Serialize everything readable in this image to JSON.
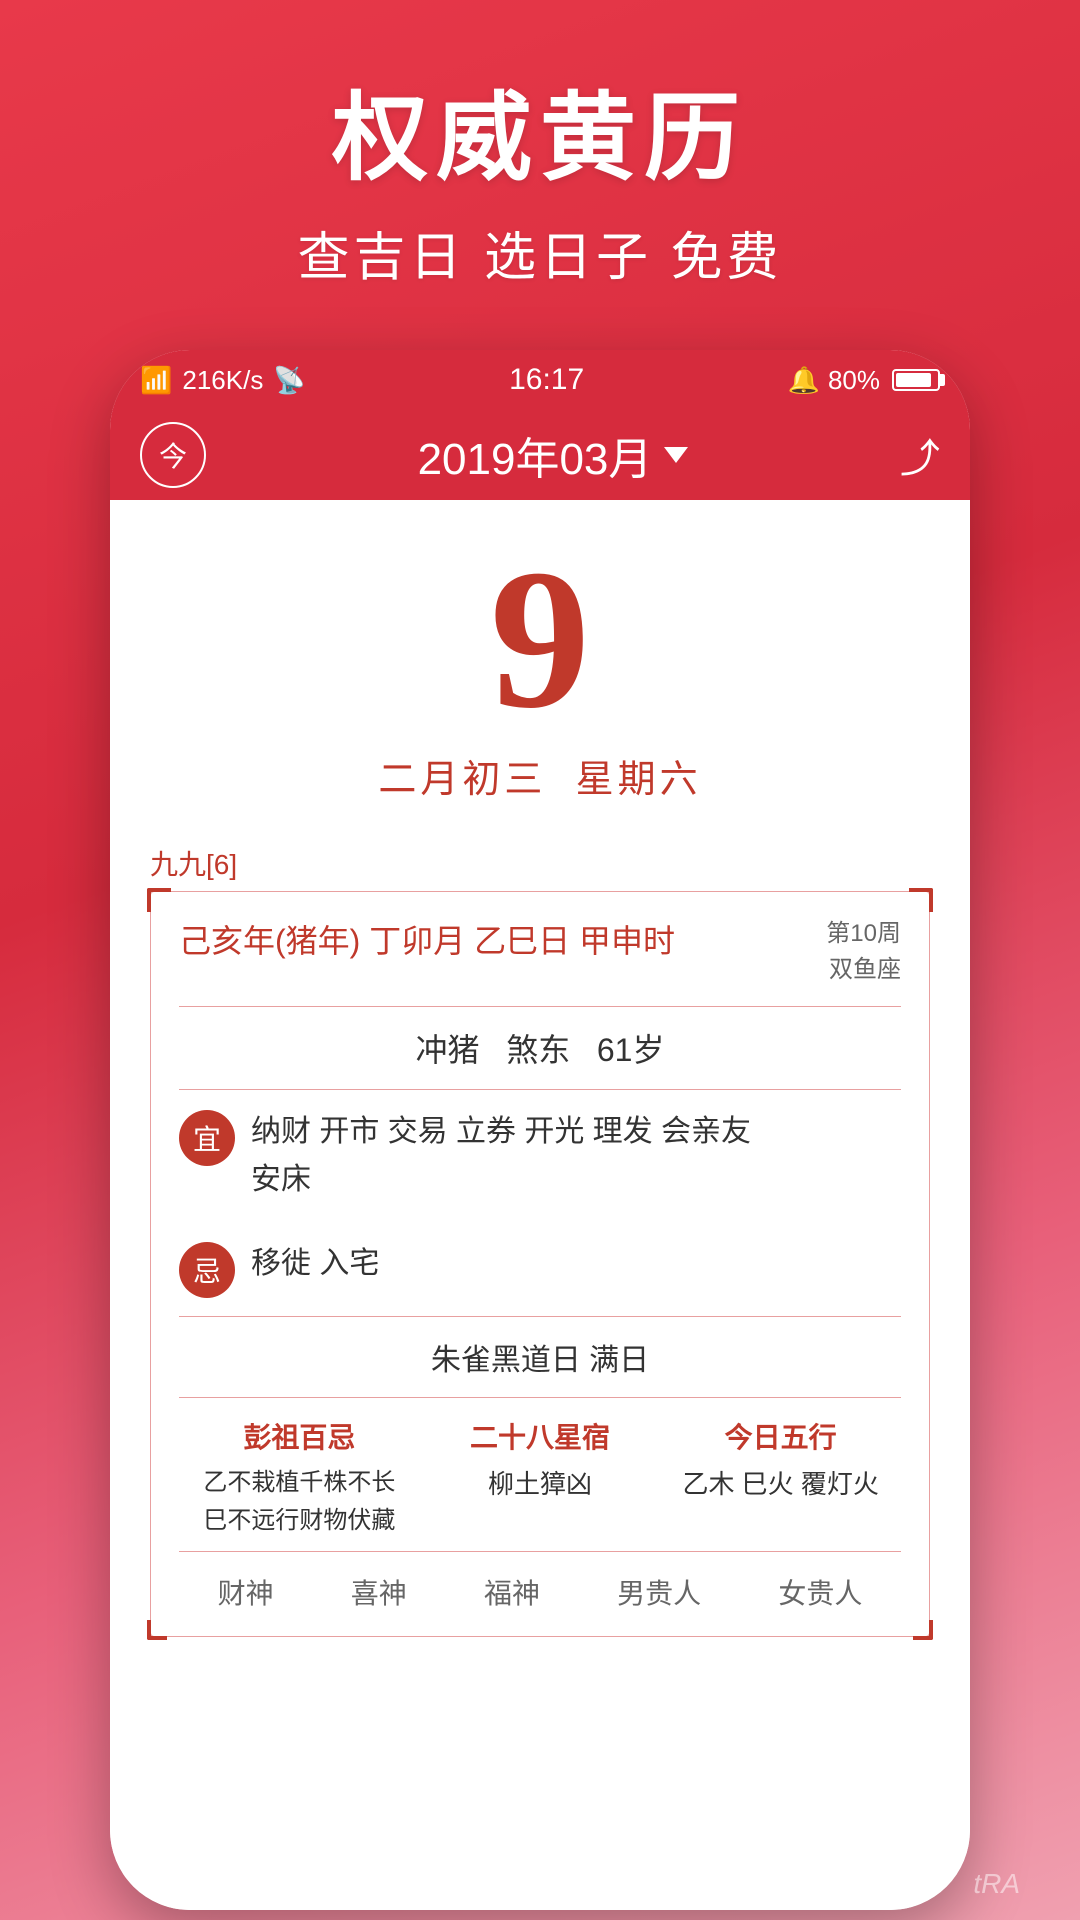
{
  "top": {
    "title": "权威黄历",
    "subtitle": "查吉日 选日子 免费"
  },
  "status_bar": {
    "signal": "4G",
    "speed": "216K/s",
    "wifi": "WiFi",
    "time": "16:17",
    "alarm": "🔔",
    "battery_pct": "80%"
  },
  "header": {
    "today_label": "今",
    "month_title": "2019年03月",
    "share_label": "分享"
  },
  "calendar": {
    "day_number": "9",
    "lunar_date": "二月初三",
    "weekday": "星期六"
  },
  "jiu_label": "九九[6]",
  "detail": {
    "ganzhi": "己亥年(猪年) 丁卯月 乙巳日 甲申时",
    "week_info": "第10周",
    "zodiac": "双鱼座",
    "chong": "冲猪",
    "sha": "煞东",
    "age": "61岁",
    "yi_badge": "宜",
    "yi_content": "纳财 开市 交易 立券 开光 理发 会亲友\n安床",
    "ji_badge": "忌",
    "ji_content": "移徙 入宅",
    "zhaque": "朱雀黑道日  满日",
    "pengzu_title": "彭祖百忌",
    "pengzu_content": "乙不栽植千株不长\n巳不远行财物伏藏",
    "ershiba_title": "二十八星宿",
    "ershiba_content": "柳土獐凶",
    "wuxing_title": "今日五行",
    "wuxing_content": "乙木 巳火 覆灯火",
    "footer_items": [
      "财神",
      "喜神",
      "福神",
      "男贵人",
      "女贵人"
    ]
  },
  "watermark": "tRA"
}
